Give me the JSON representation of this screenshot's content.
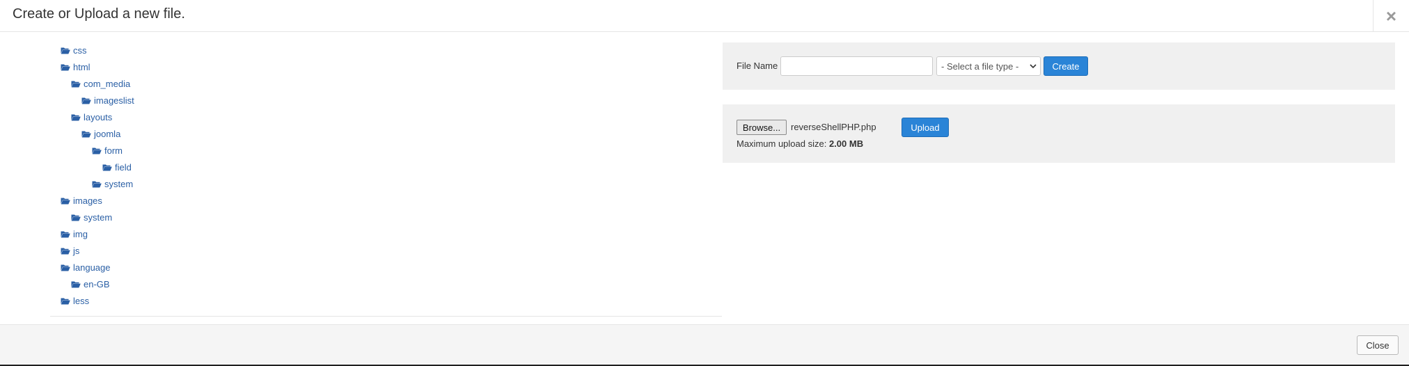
{
  "dialog": {
    "title": "Create or Upload a new file.",
    "close_symbol": "×"
  },
  "tree": {
    "items": [
      {
        "label": "css",
        "depth": 0,
        "icon": "folder-open-icon"
      },
      {
        "label": "html",
        "depth": 0,
        "icon": "folder-open-icon"
      },
      {
        "label": "com_media",
        "depth": 1,
        "icon": "folder-open-icon"
      },
      {
        "label": "imageslist",
        "depth": 2,
        "icon": "folder-open-icon"
      },
      {
        "label": "layouts",
        "depth": 1,
        "icon": "folder-open-icon"
      },
      {
        "label": "joomla",
        "depth": 2,
        "icon": "folder-open-icon"
      },
      {
        "label": "form",
        "depth": 3,
        "icon": "folder-open-icon"
      },
      {
        "label": "field",
        "depth": 4,
        "icon": "folder-open-icon"
      },
      {
        "label": "system",
        "depth": 3,
        "icon": "folder-open-icon"
      },
      {
        "label": "images",
        "depth": 0,
        "icon": "folder-open-icon"
      },
      {
        "label": "system",
        "depth": 1,
        "icon": "folder-open-icon"
      },
      {
        "label": "img",
        "depth": 0,
        "icon": "folder-open-icon"
      },
      {
        "label": "js",
        "depth": 0,
        "icon": "folder-open-icon"
      },
      {
        "label": "language",
        "depth": 0,
        "icon": "folder-open-icon"
      },
      {
        "label": "en-GB",
        "depth": 1,
        "icon": "folder-open-icon"
      },
      {
        "label": "less",
        "depth": 0,
        "icon": "folder-open-icon"
      }
    ]
  },
  "create": {
    "file_name_label": "File Name",
    "file_name_value": "",
    "file_type_selected": "- Select a file type -",
    "create_button": "Create"
  },
  "upload": {
    "browse_button": "Browse...",
    "selected_file": "reverseShellPHP.php",
    "upload_button": "Upload",
    "max_size_label": "Maximum upload size:",
    "max_size_value": "2.00 MB"
  },
  "footer": {
    "close_button": "Close"
  },
  "colors": {
    "primary": "#2a84d7",
    "link": "#2a5fa5",
    "panel_bg": "#f0f0f0",
    "footer_bg": "#f5f5f5"
  }
}
